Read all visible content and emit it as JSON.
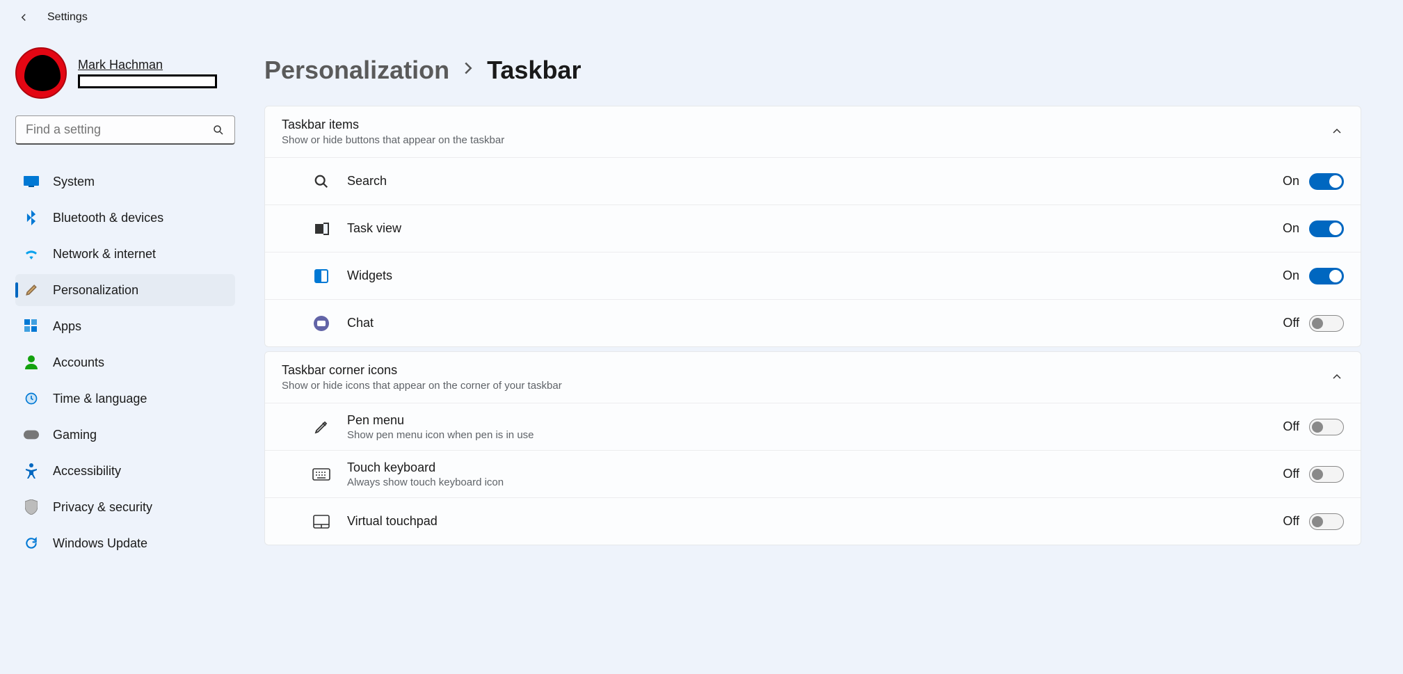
{
  "titlebar": {
    "app_name": "Settings"
  },
  "profile": {
    "name": "Mark Hachman"
  },
  "search": {
    "placeholder": "Find a setting"
  },
  "sidebar": {
    "items": [
      {
        "label": "System"
      },
      {
        "label": "Bluetooth & devices"
      },
      {
        "label": "Network & internet"
      },
      {
        "label": "Personalization"
      },
      {
        "label": "Apps"
      },
      {
        "label": "Accounts"
      },
      {
        "label": "Time & language"
      },
      {
        "label": "Gaming"
      },
      {
        "label": "Accessibility"
      },
      {
        "label": "Privacy & security"
      },
      {
        "label": "Windows Update"
      }
    ]
  },
  "breadcrumb": {
    "parent": "Personalization",
    "current": "Taskbar"
  },
  "sections": {
    "taskbar_items": {
      "title": "Taskbar items",
      "subtitle": "Show or hide buttons that appear on the taskbar",
      "rows": [
        {
          "label": "Search",
          "state": "On"
        },
        {
          "label": "Task view",
          "state": "On"
        },
        {
          "label": "Widgets",
          "state": "On"
        },
        {
          "label": "Chat",
          "state": "Off"
        }
      ]
    },
    "corner_icons": {
      "title": "Taskbar corner icons",
      "subtitle": "Show or hide icons that appear on the corner of your taskbar",
      "rows": [
        {
          "label": "Pen menu",
          "sub": "Show pen menu icon when pen is in use",
          "state": "Off"
        },
        {
          "label": "Touch keyboard",
          "sub": "Always show touch keyboard icon",
          "state": "Off"
        },
        {
          "label": "Virtual touchpad",
          "sub": "",
          "state": "Off"
        }
      ]
    }
  },
  "state_labels": {
    "on": "On",
    "off": "Off"
  }
}
